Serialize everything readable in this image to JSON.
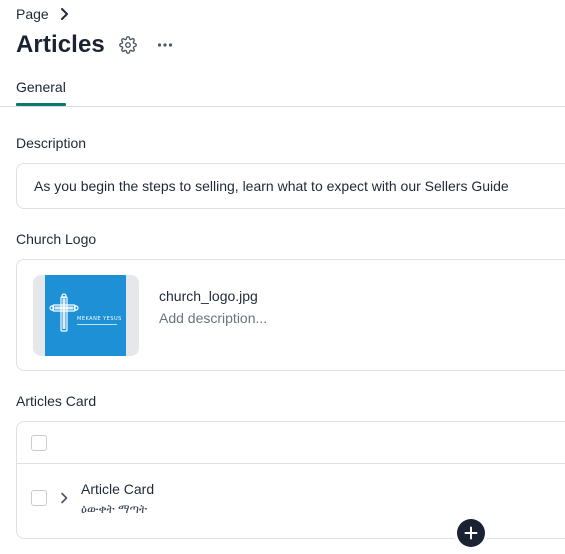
{
  "breadcrumb": {
    "label": "Page",
    "icon": "chevron-right-icon"
  },
  "header": {
    "title": "Articles",
    "settings_icon": "gear-icon",
    "more_icon": "ellipsis-icon"
  },
  "tabs": [
    {
      "label": "General",
      "active": true
    }
  ],
  "description": {
    "label": "Description",
    "value": "As you begin the steps to selling, learn what to expect with our Sellers Guide"
  },
  "church_logo": {
    "label": "Church Logo",
    "file_name": "church_logo.jpg",
    "description_placeholder": "Add description...",
    "logo_text": "MEKANE YESUS"
  },
  "articles_card": {
    "label": "Articles Card",
    "rows": [
      {
        "title": "Article Card",
        "subtitle": "ዕውቀት ማጣት"
      }
    ]
  },
  "colors": {
    "accent": "#0f766e",
    "primary_dark": "#1b2233",
    "logo_background": "#1d90d6"
  }
}
